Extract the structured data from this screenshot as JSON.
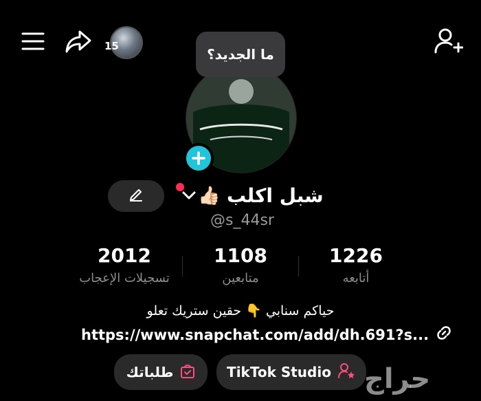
{
  "tooltip": {
    "text": "ما الجديد؟"
  },
  "story": {
    "count": "15"
  },
  "profile": {
    "name": "شبل اكلب",
    "name_emoji": "👍🏻",
    "handle": "@s_44sr"
  },
  "stats": [
    {
      "value": "1226",
      "label": "أتابعه"
    },
    {
      "value": "1108",
      "label": "متابعين"
    },
    {
      "value": "2012",
      "label": "تسجيلات الإعجاب"
    }
  ],
  "bio": {
    "text": "حياكم سنابي 👇 حقين ستريك تعلو",
    "link": "https://www.snapchat.com/add/dh.691?s..."
  },
  "buttons": {
    "studio": "TikTok Studio",
    "orders": "طلباتك"
  },
  "watermark": {
    "text": "حراج"
  },
  "colors": {
    "background": "#000000",
    "accent": "#21c4d8",
    "notify": "#ff2d55",
    "studio_icon": "#ff4d7d",
    "muted": "#8e8e8e"
  }
}
